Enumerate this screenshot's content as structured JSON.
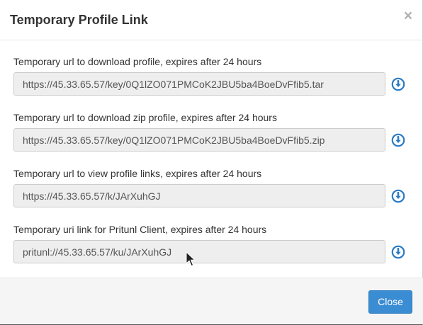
{
  "dialog": {
    "title": "Temporary Profile Link",
    "close_symbol": "×"
  },
  "fields": [
    {
      "label": "Temporary url to download profile, expires after 24 hours",
      "value": "https://45.33.65.57/key/0Q1lZO071PMCoK2JBU5ba4BoeDvFfib5.tar",
      "icon": "download-circle-icon"
    },
    {
      "label": "Temporary url to download zip profile, expires after 24 hours",
      "value": "https://45.33.65.57/key/0Q1lZO071PMCoK2JBU5ba4BoeDvFfib5.zip",
      "icon": "download-circle-icon"
    },
    {
      "label": "Temporary url to view profile links, expires after 24 hours",
      "value": "https://45.33.65.57/k/JArXuhGJ",
      "icon": "download-circle-icon"
    },
    {
      "label": "Temporary uri link for Pritunl Client, expires after 24 hours",
      "value": "pritunl://45.33.65.57/ku/JArXuhGJ",
      "icon": "download-circle-icon"
    }
  ],
  "footer": {
    "close_label": "Close"
  },
  "colors": {
    "accent": "#3b8dd3",
    "icon": "#2a7bc4",
    "input_bg": "#eeeeee"
  }
}
